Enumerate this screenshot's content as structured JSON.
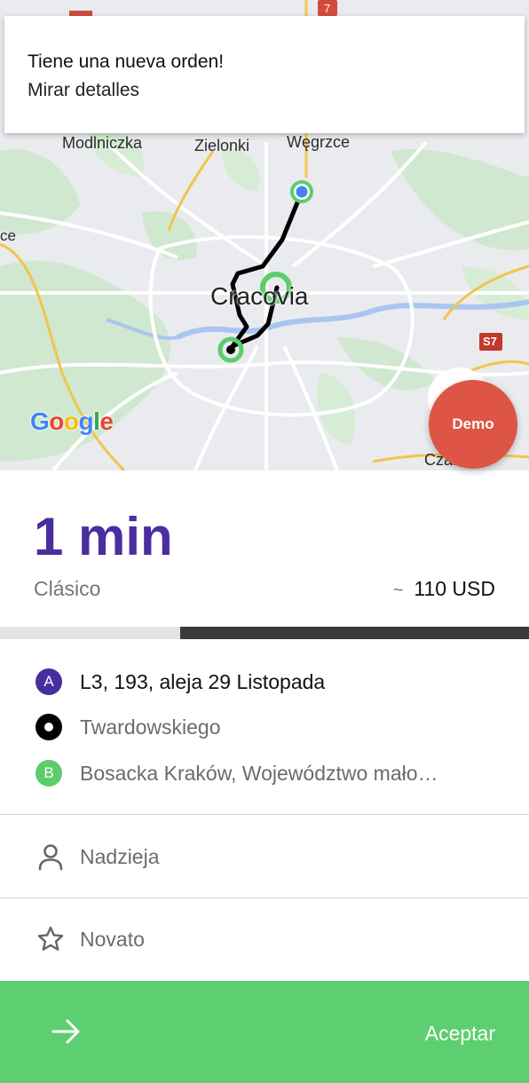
{
  "notification": {
    "title": "Tiene una nueva orden!",
    "subtitle": "Mirar detalles"
  },
  "map": {
    "labels": {
      "modlniczka": "Modlniczka",
      "zielonki": "Zielonki",
      "wegrzce": "Węgrzce",
      "city": "Cracovia",
      "edge_left": "ce",
      "edge_right": "Czarnowi",
      "road_7": "7",
      "road_s7": "S7"
    },
    "attribution": "Google",
    "colors": {
      "route": "#000000",
      "pin_green": "#5ccc6c",
      "current_location": "#4285f4"
    }
  },
  "demo_button": "Demo",
  "order": {
    "eta": "1 min",
    "tariff": "Clásico",
    "price_prefix": "~",
    "price": "110 USD",
    "progress": 0.66
  },
  "route": {
    "pickup_marker": "A",
    "pickup": "L3, 193, aleja 29 Listopada",
    "stop": "Twardowskiego",
    "dropoff_marker": "B",
    "dropoff": "Bosacka Kraków, Województwo mało…"
  },
  "client": {
    "name": "Nadzieja",
    "rating": "Novato"
  },
  "accept": {
    "label": "Aceptar"
  },
  "colors": {
    "accent": "#4a2ea0",
    "green": "#5ecf70",
    "demo": "#de5546"
  }
}
